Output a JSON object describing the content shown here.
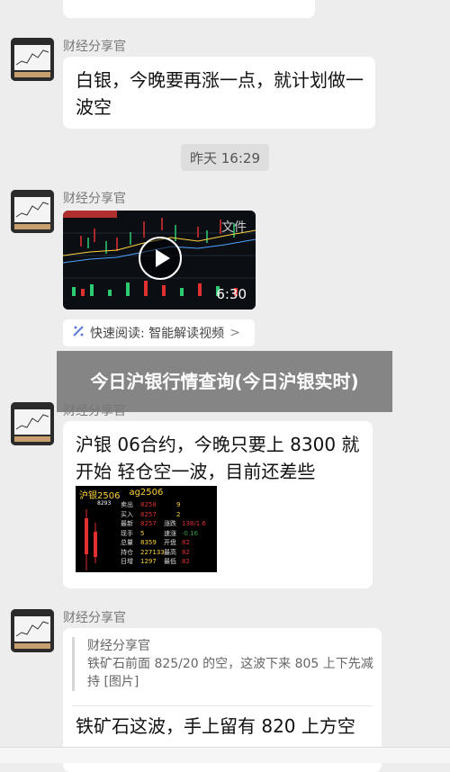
{
  "messages": [
    {
      "sender": "财经分享官",
      "text": "白银，今晚要再涨一点，就计划做一波空"
    },
    {
      "sender": "财经分享官",
      "video_duration": "6:30",
      "video_overlay_text": "文件"
    },
    {
      "sender": "财经分享官",
      "text": "沪银 06合约，今晚只要上 8300 就开始 轻仓空一波，目前还差些"
    },
    {
      "sender": "财经分享官",
      "quote": {
        "author": "财经分享官",
        "text": "铁矿石前面 825/20 的空，这波下来 805 上下先减持 [图片]"
      },
      "text": "铁矿石这波，手上留有 820 上方空"
    }
  ],
  "timestamp": "昨天 16:29",
  "quick_read": {
    "label": "快速阅读: 智能解读视频",
    "chevron": ">"
  },
  "banner": {
    "title": "今日沪银行情查询(今日沪银实时)"
  },
  "quote_panel": {
    "header": [
      "沪银2506",
      "ag2506"
    ],
    "rows": [
      {
        "label": "卖出",
        "value": "8258",
        "value2": "9"
      },
      {
        "label": "买入",
        "value": "8257",
        "value2": "2"
      },
      {
        "label": "最新",
        "value": "8257",
        "label2": "涨跌",
        "value3": "138/1.6"
      },
      {
        "label": "现手",
        "value": "5",
        "label2": "速涨",
        "value3": "-0.16"
      },
      {
        "label": "总量",
        "value": "8359",
        "label2": "开盘",
        "value3": "82"
      },
      {
        "label": "持仓",
        "value": "227133",
        "label2": "最高",
        "value3": "82"
      },
      {
        "label": "日增",
        "value": "1297",
        "label2": "最低",
        "value3": "82"
      }
    ],
    "price_tag": "8293"
  },
  "colors": {
    "background": "#ededed",
    "bubble": "#ffffff",
    "up": "#e03030",
    "down": "#2ea043"
  },
  "icons": [
    "avatar-chart-image",
    "play-icon",
    "sparkle-icon",
    "chevron-right-icon"
  ]
}
